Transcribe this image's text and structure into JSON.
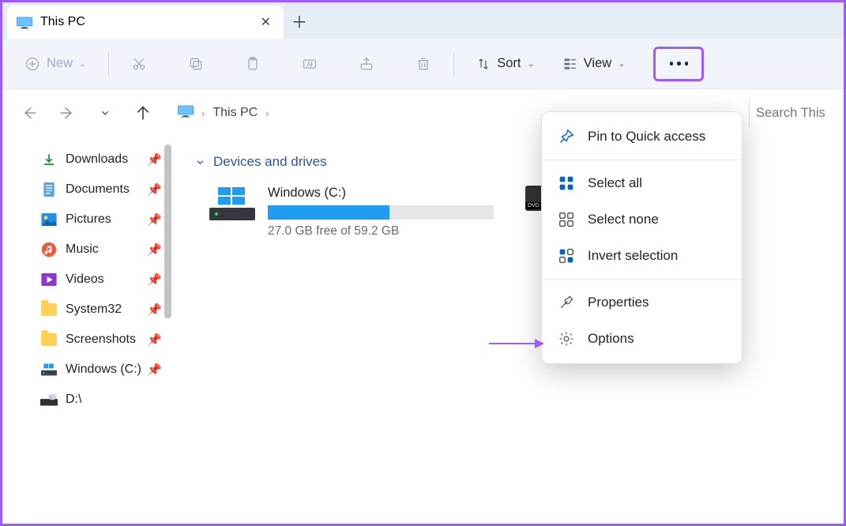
{
  "tab": {
    "title": "This PC"
  },
  "toolbar": {
    "new_label": "New",
    "sort_label": "Sort",
    "view_label": "View"
  },
  "breadcrumb": {
    "location": "This PC"
  },
  "search": {
    "placeholder": "Search This PC"
  },
  "sidebar": {
    "items": [
      {
        "label": "Downloads",
        "icon": "download",
        "pinned": true
      },
      {
        "label": "Documents",
        "icon": "document",
        "pinned": true
      },
      {
        "label": "Pictures",
        "icon": "pictures",
        "pinned": true
      },
      {
        "label": "Music",
        "icon": "music",
        "pinned": true
      },
      {
        "label": "Videos",
        "icon": "videos",
        "pinned": true
      },
      {
        "label": "System32",
        "icon": "folder",
        "pinned": true
      },
      {
        "label": "Screenshots",
        "icon": "folder",
        "pinned": true
      },
      {
        "label": "Windows (C:)",
        "icon": "disk",
        "pinned": true
      },
      {
        "label": "D:\\",
        "icon": "dvd",
        "pinned": false
      }
    ]
  },
  "main": {
    "section_title": "Devices and drives",
    "drive_c": {
      "name": "Windows (C:)",
      "free_text": "27.0 GB free of 59.2 GB",
      "fill_pct": 54
    }
  },
  "menu": {
    "pin": "Pin to Quick access",
    "select_all": "Select all",
    "select_none": "Select none",
    "invert": "Invert selection",
    "properties": "Properties",
    "options": "Options"
  }
}
